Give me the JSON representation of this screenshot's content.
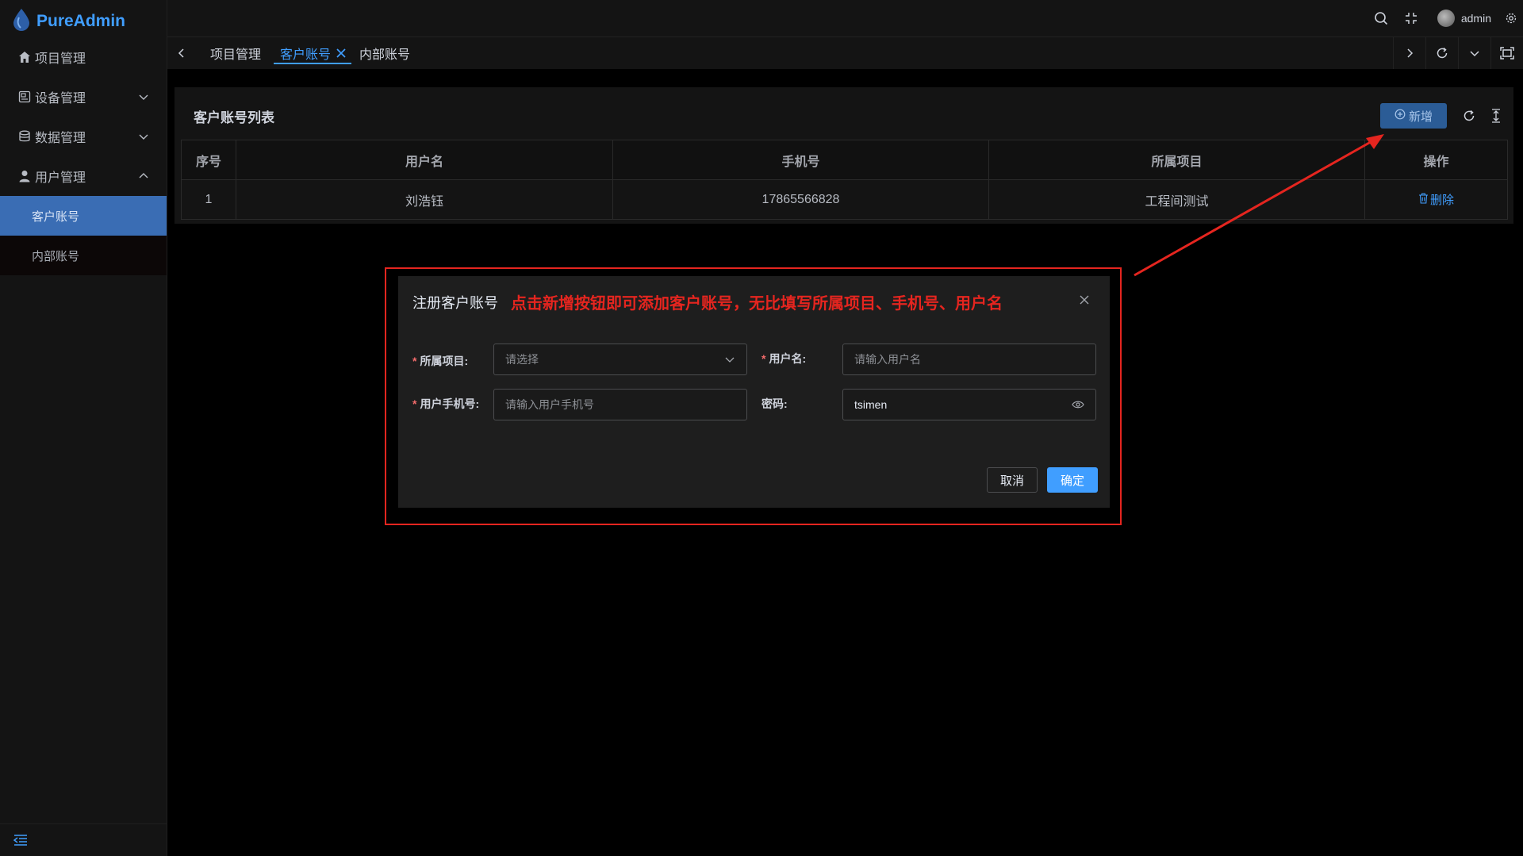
{
  "app": {
    "logo_text": "PureAdmin"
  },
  "sidebar": {
    "items": [
      {
        "label": "项目管理",
        "icon": "home-icon"
      },
      {
        "label": "设备管理",
        "icon": "device-icon"
      },
      {
        "label": "数据管理",
        "icon": "database-icon"
      },
      {
        "label": "用户管理",
        "icon": "user-icon"
      }
    ],
    "sub_items": [
      {
        "label": "客户账号",
        "active": true
      },
      {
        "label": "内部账号",
        "active": false
      }
    ]
  },
  "header": {
    "user_name": "admin"
  },
  "tabs": [
    {
      "label": "项目管理"
    },
    {
      "label": "客户账号",
      "active": true
    },
    {
      "label": "内部账号"
    }
  ],
  "card": {
    "title": "客户账号列表",
    "add_label": "新增",
    "columns": [
      "序号",
      "用户名",
      "手机号",
      "所属项目",
      "操作"
    ],
    "rows": [
      {
        "index": "1",
        "username": "刘浩钰",
        "phone": "17865566828",
        "project": "工程间测试",
        "action": "删除"
      }
    ]
  },
  "dialog": {
    "title": "注册客户账号",
    "annotation": "点击新增按钮即可添加客户账号，无比填写所属项目、手机号、用户名",
    "fields": {
      "project": {
        "label": "所属项目:",
        "placeholder": "请选择"
      },
      "username": {
        "label": "用户名:",
        "placeholder": "请输入用户名"
      },
      "phone": {
        "label": "用户手机号:",
        "placeholder": "请输入用户手机号"
      },
      "password": {
        "label": "密码:",
        "value": "tsimen"
      }
    },
    "cancel_label": "取消",
    "confirm_label": "确定"
  },
  "colors": {
    "accent": "#409eff",
    "annotation_red": "#e5251f",
    "active_menu": "#3a6db4"
  }
}
